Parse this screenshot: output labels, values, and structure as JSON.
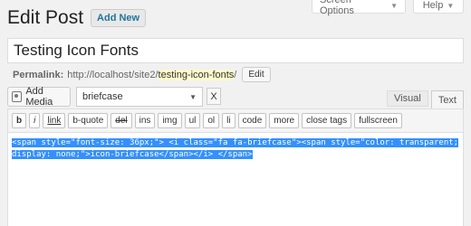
{
  "screen_tabs": {
    "options_label": "Screen Options",
    "help_label": "Help"
  },
  "header": {
    "title": "Edit Post",
    "add_new_label": "Add New"
  },
  "post_title": {
    "value": "Testing Icon Fonts"
  },
  "permalink": {
    "label": "Permalink:",
    "base_url": "http://localhost/site2/",
    "slug": "testing-icon-fonts",
    "trailing": "/",
    "edit_label": "Edit"
  },
  "media": {
    "add_media_label": "Add Media",
    "icon": "media-icon"
  },
  "icon_select": {
    "value": "briefcase",
    "clear_label": "X"
  },
  "editor_tabs": {
    "visual": "Visual",
    "text": "Text"
  },
  "quicktags": [
    "b",
    "i",
    "link",
    "b-quote",
    "del",
    "ins",
    "img",
    "ul",
    "ol",
    "li",
    "code",
    "more",
    "close tags",
    "fullscreen"
  ],
  "content": {
    "line1": "<span style=\"font-size: 36px;\"> <i class=\"fa fa-briefcase\"><span style=\"color: transparent;",
    "line2": "display: none;\">icon-briefcase</span></i> </span>"
  },
  "colors": {
    "background": "#f1f1f1",
    "selection": "#3390ff",
    "link": "#21759b"
  }
}
